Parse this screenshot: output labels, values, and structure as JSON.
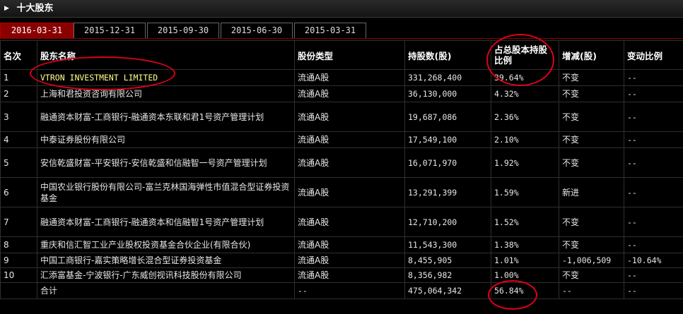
{
  "title": "十大股东",
  "tabs": [
    "2016-03-31",
    "2015-12-31",
    "2015-09-30",
    "2015-06-30",
    "2015-03-31"
  ],
  "headers": [
    "名次",
    "股东名称",
    "股份类型",
    "持股数(股)",
    "占总股本持股比例",
    "增减(股)",
    "变动比例"
  ],
  "rows": [
    {
      "rank": "1",
      "name": "VTRON INVESTMENT LIMITED",
      "type": "流通A股",
      "shares": "331,268,400",
      "ratio": "39.64%",
      "change": "不变",
      "change_ratio": "--"
    },
    {
      "rank": "2",
      "name": "上海和君投资咨询有限公司",
      "type": "流通A股",
      "shares": "36,130,000",
      "ratio": "4.32%",
      "change": "不变",
      "change_ratio": "--"
    },
    {
      "rank": "3",
      "name": "融通资本财富-工商银行-融通资本东联和君1号资产管理计划",
      "type": "流通A股",
      "shares": "19,687,086",
      "ratio": "2.36%",
      "change": "不变",
      "change_ratio": "--"
    },
    {
      "rank": "4",
      "name": "中泰证券股份有限公司",
      "type": "流通A股",
      "shares": "17,549,100",
      "ratio": "2.10%",
      "change": "不变",
      "change_ratio": "--"
    },
    {
      "rank": "5",
      "name": "安信乾盛财富-平安银行-安信乾盛和信融智一号资产管理计划",
      "type": "流通A股",
      "shares": "16,071,970",
      "ratio": "1.92%",
      "change": "不变",
      "change_ratio": "--"
    },
    {
      "rank": "6",
      "name": "中国农业银行股份有限公司-富兰克林国海弹性市值混合型证券投资基金",
      "type": "流通A股",
      "shares": "13,291,399",
      "ratio": "1.59%",
      "change": "新进",
      "change_ratio": "--"
    },
    {
      "rank": "7",
      "name": "融通资本财富-工商银行-融通资本和信融智1号资产管理计划",
      "type": "流通A股",
      "shares": "12,710,200",
      "ratio": "1.52%",
      "change": "不变",
      "change_ratio": "--"
    },
    {
      "rank": "8",
      "name": "重庆和信汇智工业产业股权投资基金合伙企业(有限合伙)",
      "type": "流通A股",
      "shares": "11,543,300",
      "ratio": "1.38%",
      "change": "不变",
      "change_ratio": "--"
    },
    {
      "rank": "9",
      "name": "中国工商银行-嘉实策略增长混合型证券投资基金",
      "type": "流通A股",
      "shares": "8,455,905",
      "ratio": "1.01%",
      "change": "-1,006,509",
      "change_ratio": "-10.64%"
    },
    {
      "rank": "10",
      "name": "汇添富基金-宁波银行-广东威创视讯科技股份有限公司",
      "type": "流通A股",
      "shares": "8,356,982",
      "ratio": "1.00%",
      "change": "不变",
      "change_ratio": "--"
    }
  ],
  "total": {
    "rank": "",
    "name": "合计",
    "type": "--",
    "shares": "475,064,342",
    "ratio": "56.84%",
    "change": "--",
    "change_ratio": "--"
  },
  "colors": {
    "accent": "#8a0000",
    "circle": "#e0001a",
    "highlight": "#ffff88"
  }
}
